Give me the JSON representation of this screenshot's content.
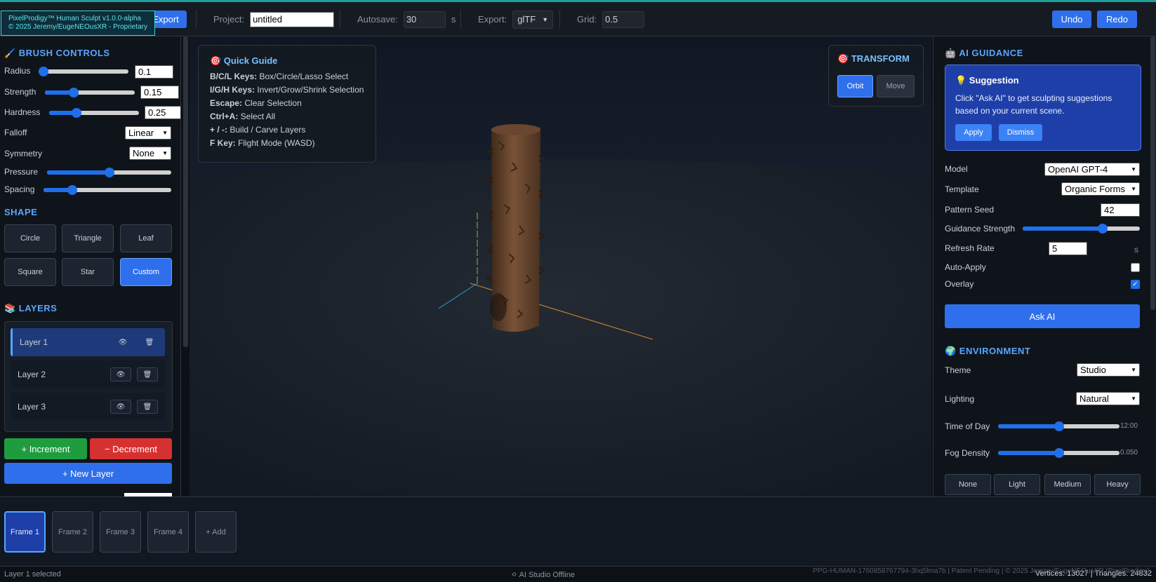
{
  "brand": {
    "line1": "PixelProdigy™ Human Sculpt v1.0.0-alpha",
    "line2": "© 2025 Jeremy/EugeNEOusXR - Proprietary"
  },
  "toolbar": {
    "export_button": "Export",
    "project_label": "Project:",
    "project_value": "untitled",
    "autosave_label": "Autosave:",
    "autosave_value": "30",
    "autosave_unit": "s",
    "export_label": "Export:",
    "export_format": "glTF",
    "grid_label": "Grid:",
    "grid_value": "0.5",
    "undo": "Undo",
    "redo": "Redo"
  },
  "brush": {
    "title": "🖌️ BRUSH CONTROLS",
    "radius_label": "Radius",
    "radius_value": "0.1",
    "radius_level": 0.0,
    "strength_label": "Strength",
    "strength_value": "0.15",
    "strength_level": 0.3,
    "hardness_label": "Hardness",
    "hardness_value": "0.25",
    "hardness_level": 0.28,
    "falloff_label": "Falloff",
    "falloff_value": "Linear",
    "symmetry_label": "Symmetry",
    "symmetry_value": "None",
    "pressure_label": "Pressure",
    "pressure_level": 0.5,
    "spacing_label": "Spacing",
    "spacing_level": 0.2
  },
  "shape": {
    "title": "SHAPE",
    "buttons": [
      "Circle",
      "Triangle",
      "Leaf",
      "Square",
      "Star",
      "Custom"
    ],
    "active": "Custom"
  },
  "layers": {
    "title": "📚 LAYERS",
    "items": [
      "Layer 1",
      "Layer 2",
      "Layer 3"
    ],
    "increment": "+ Increment",
    "decrement": "− Decrement",
    "new_layer": "+ New Layer"
  },
  "guide": {
    "title": "🎯 Quick Guide",
    "lines": [
      {
        "key": "B/C/L Keys:",
        "desc": " Box/Circle/Lasso Select"
      },
      {
        "key": "I/G/H Keys:",
        "desc": " Invert/Grow/Shrink Selection"
      },
      {
        "key": "Escape:",
        "desc": " Clear Selection"
      },
      {
        "key": "Ctrl+A:",
        "desc": " Select All"
      },
      {
        "key": "+ / -:",
        "desc": " Build / Carve Layers"
      },
      {
        "key": "F Key:",
        "desc": " Flight Mode (WASD)"
      }
    ]
  },
  "transform": {
    "title": "🎯 TRANSFORM",
    "orbit": "Orbit",
    "move": "Move"
  },
  "ai": {
    "title": "🤖 AI GUIDANCE",
    "suggestion_title": "💡 Suggestion",
    "suggestion_text": "Click \"Ask AI\" to get sculpting suggestions based on your current scene.",
    "apply": "Apply",
    "dismiss": "Dismiss",
    "model_label": "Model",
    "model_value": "OpenAI GPT-4",
    "template_label": "Template",
    "template_value": "Organic Forms",
    "seed_label": "Pattern Seed",
    "seed_value": "42",
    "guidance_label": "Guidance Strength",
    "guidance_level": 0.7,
    "refresh_label": "Refresh Rate",
    "refresh_value": "5",
    "refresh_unit": "s",
    "autoapply_label": "Auto-Apply",
    "autoapply": false,
    "overlay_label": "Overlay",
    "overlay": true,
    "ask_button": "Ask AI"
  },
  "environment": {
    "title": "🌍 ENVIRONMENT",
    "theme_label": "Theme",
    "theme_value": "Studio",
    "lighting_label": "Lighting",
    "lighting_value": "Natural",
    "time_label": "Time of Day",
    "time_value": "12:00",
    "time_level": 0.5,
    "fog_label": "Fog Density",
    "fog_value": "0.050",
    "fog_level": 0.5,
    "fog_buttons": [
      "None",
      "Light",
      "Medium",
      "Heavy"
    ]
  },
  "frames": {
    "items": [
      "Frame 1",
      "Frame 2",
      "Frame 3",
      "Frame 4"
    ],
    "add": "+ Add"
  },
  "status": {
    "left": "Layer 1 selected",
    "center": "⚪ AI Studio Offline",
    "watermark": "PPG-HUMAN-1760858767794-3hq5lma7b | Patent Pending | © 2025 Jeremy/EugeNEOusXR (PixelProdigy)",
    "stats": "Vertices: 13027 | Triangles: 24832"
  },
  "colors": {
    "accent": "#2f6feb",
    "increment": "#1f9d3e",
    "decrement": "#d63131",
    "heading": "#58a6ff"
  }
}
